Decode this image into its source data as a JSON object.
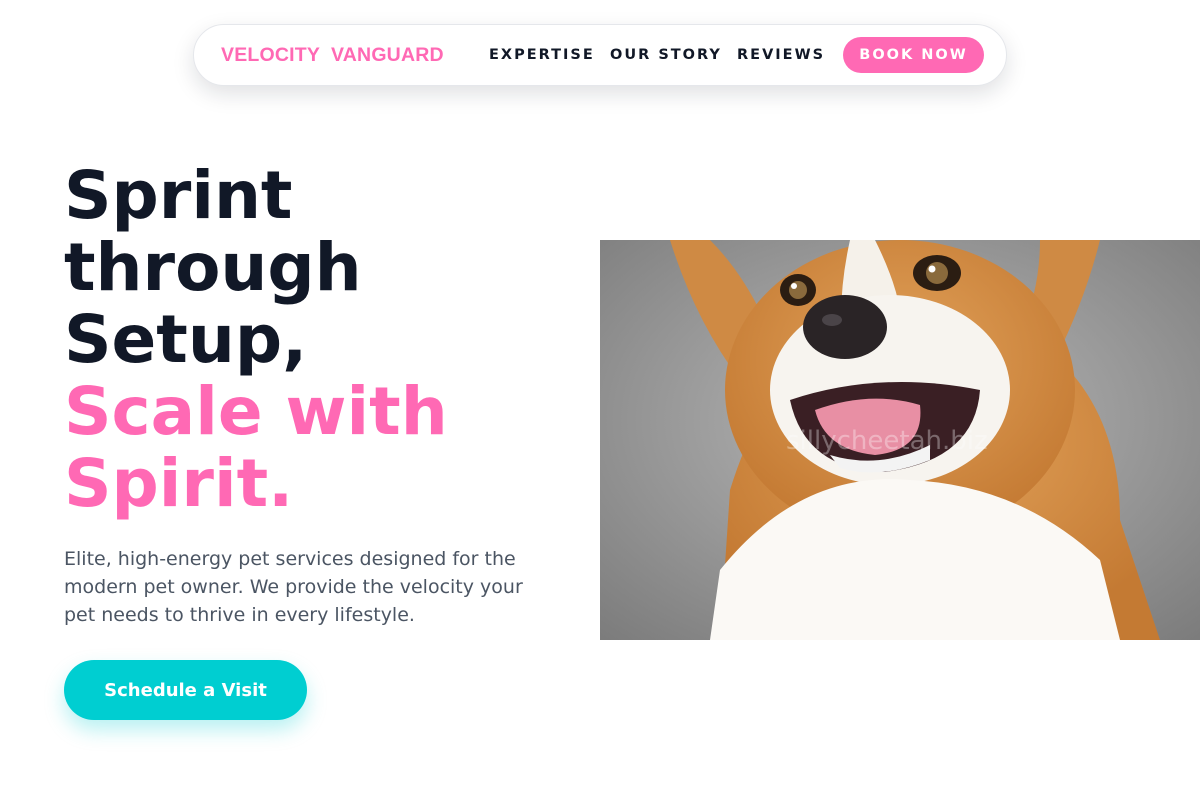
{
  "nav": {
    "logo": "VELOCITY  VANGUARD",
    "links": [
      "EXPERTISE",
      "OUR STORY",
      "REVIEWS"
    ],
    "cta_label": "BOOK NOW"
  },
  "hero": {
    "headline_dark": [
      "Sprint",
      "through",
      "Setup,"
    ],
    "headline_accent": [
      "Scale with",
      "Spirit."
    ],
    "description": "Elite, high-energy pet services designed for the modern pet owner. We provide the velocity your pet needs to thrive in every lifestyle.",
    "cta_label": "Schedule a Visit",
    "image_watermark": "sillycheetah.biz"
  },
  "colors": {
    "accent_pink": "#ff69b4",
    "accent_teal": "#00ced1",
    "headline_dark": "#111827",
    "body_text": "#4b5563"
  }
}
